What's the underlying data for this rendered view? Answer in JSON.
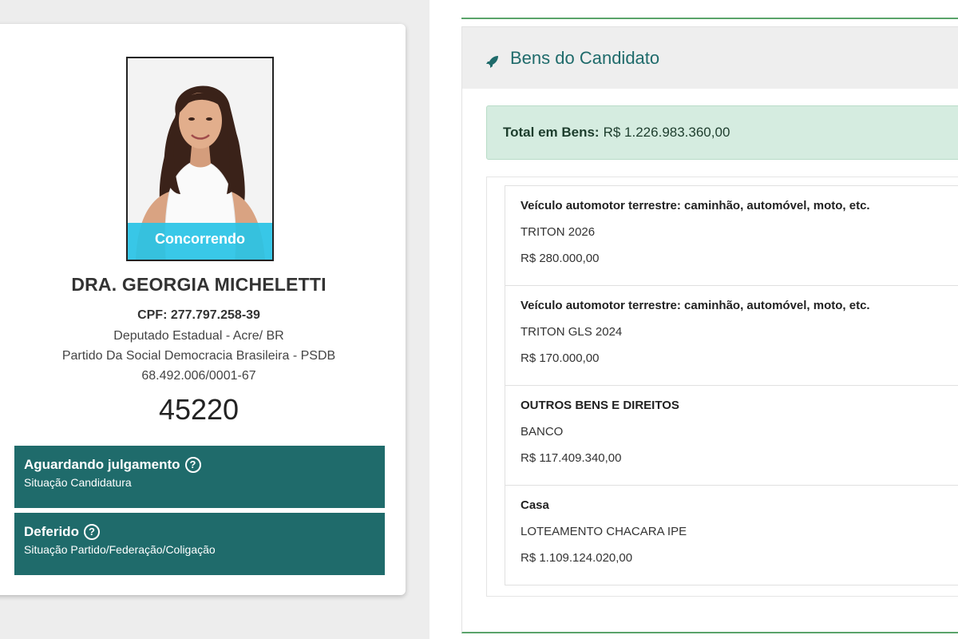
{
  "candidate": {
    "badge": "Concorrendo",
    "name": "DRA. GEORGIA MICHELETTI",
    "cpf": "CPF: 277.797.258-39",
    "office": "Deputado Estadual - Acre/ BR",
    "party": "Partido Da Social Democracia Brasileira - PSDB",
    "cnpj": "68.492.006/0001-67",
    "number": "45220",
    "statuses": [
      {
        "title": "Aguardando julgamento",
        "icon": "help-circle-icon",
        "subtitle": "Situação Candidatura"
      },
      {
        "title": "Deferido",
        "icon": "help-circle-icon",
        "subtitle": "Situação Partido/Federação/Coligação"
      }
    ]
  },
  "assets": {
    "header_icon": "rocket-icon",
    "title": "Bens do Candidato",
    "total_label": "Total em Bens:",
    "total_value": "R$ 1.226.983.360,00",
    "items": [
      {
        "type": "Veículo automotor terrestre: caminhão, automóvel, moto, etc.",
        "description": "TRITON 2026",
        "value": "R$ 280.000,00"
      },
      {
        "type": "Veículo automotor terrestre: caminhão, automóvel, moto, etc.",
        "description": "TRITON GLS 2024",
        "value": "R$ 170.000,00"
      },
      {
        "type": "OUTROS BENS E DIREITOS",
        "description": "BANCO",
        "value": "R$ 117.409.340,00"
      },
      {
        "type": "Casa",
        "description": "LOTEAMENTO CHACARA IPE",
        "value": "R$ 1.109.124.020,00"
      }
    ]
  },
  "colors": {
    "status_bg": "#1f6b6b",
    "badge_bg": "#28c3e6",
    "total_bg": "#d5ece0",
    "accent_border": "#5aa36a"
  }
}
